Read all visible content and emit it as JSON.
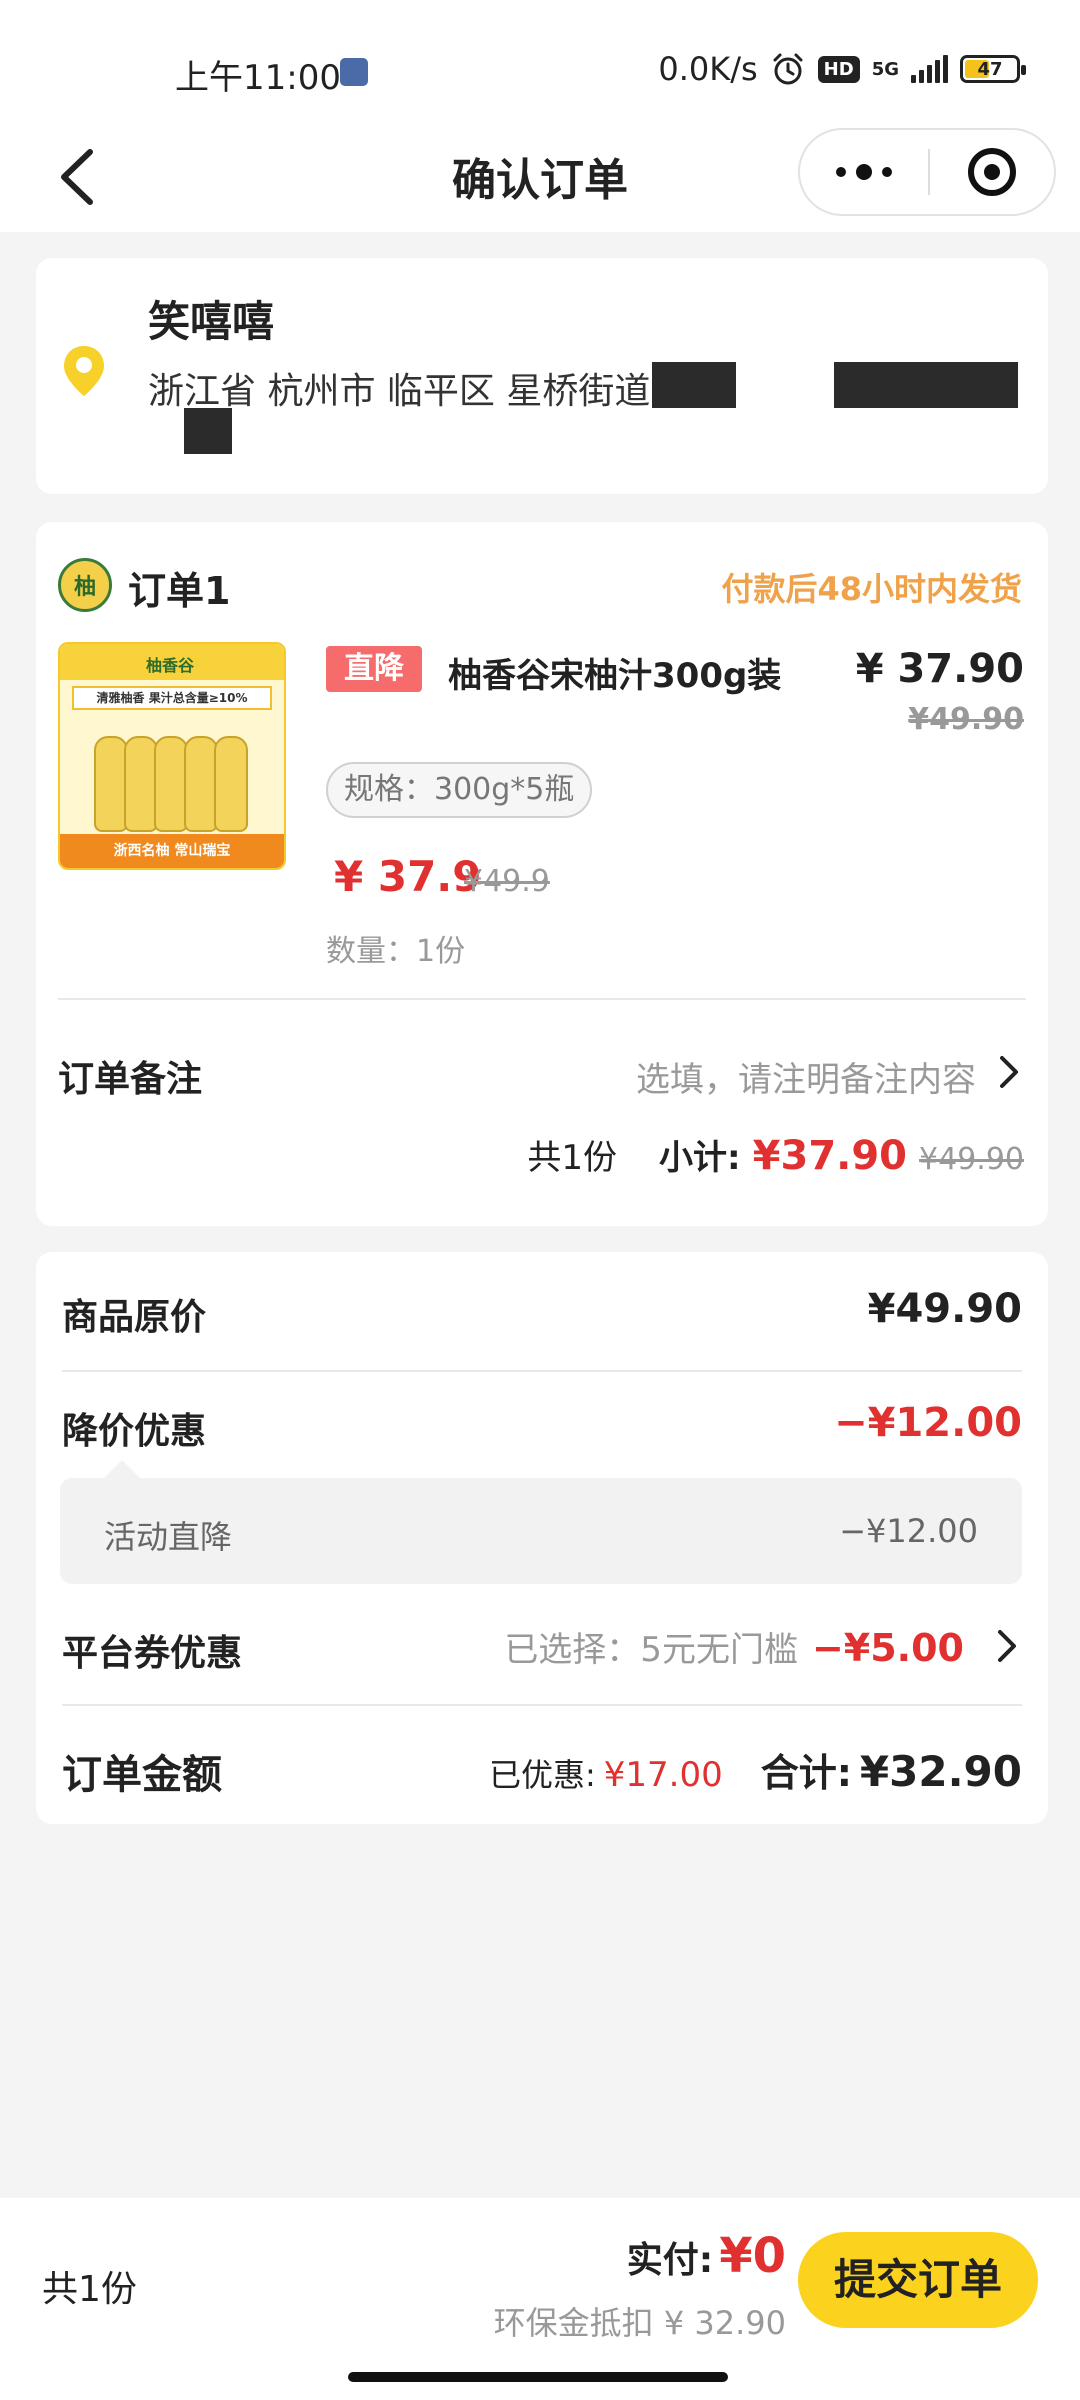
{
  "status_bar": {
    "time": "上午11:00",
    "network_speed": "0.0K/s",
    "hd_badge": "HD",
    "network_type": "5G",
    "battery": "47"
  },
  "nav": {
    "title": "确认订单"
  },
  "address": {
    "name": "笑嘻嘻",
    "detail": "浙江省 杭州市 临平区 星桥街道"
  },
  "order": {
    "title": "订单1",
    "shipping_note": "付款后48小时内发货",
    "product": {
      "image_alt": "柚香谷",
      "image_banner": "清雅柚香 果汁总含量≥10%",
      "image_footer": "浙西名柚 常山瑞宝",
      "tag": "直降",
      "name": "柚香谷宋柚汁300g装",
      "price": "¥ 37.90",
      "original_price": "¥49.90",
      "spec": "规格：300g*5瓶",
      "current_price": "¥ 37.9",
      "was_price": "¥49.9",
      "quantity": "数量：1份"
    },
    "note_label": "订单备注",
    "note_placeholder": "选填，请注明备注内容",
    "count": "共1份",
    "subtotal_label": "小计:",
    "subtotal": "¥37.90",
    "subtotal_original": "¥49.90"
  },
  "summary": {
    "original_label": "商品原价",
    "original_value": "¥49.90",
    "discount_label": "降价优惠",
    "discount_value": "−¥12.00",
    "activity_label": "活动直降",
    "activity_value": "−¥12.00",
    "coupon_label": "平台券优惠",
    "coupon_selected": "已选择：5元无门槛",
    "coupon_value": "−¥5.00",
    "total_label": "订单金额",
    "saved_label": "已优惠:",
    "saved_value": "¥17.00",
    "grand_label": "合计:",
    "grand_value": "¥32.90"
  },
  "bottom": {
    "count": "共1份",
    "pay_label": "实付:",
    "pay_value": "¥0",
    "eco_note": "环保金抵扣 ¥ 32.90",
    "submit_label": "提交订单"
  },
  "colors": {
    "accent": "#fbd31e",
    "price_red": "#e03030",
    "ship_orange": "#f0a24a",
    "tag_red": "#f66b6b"
  }
}
